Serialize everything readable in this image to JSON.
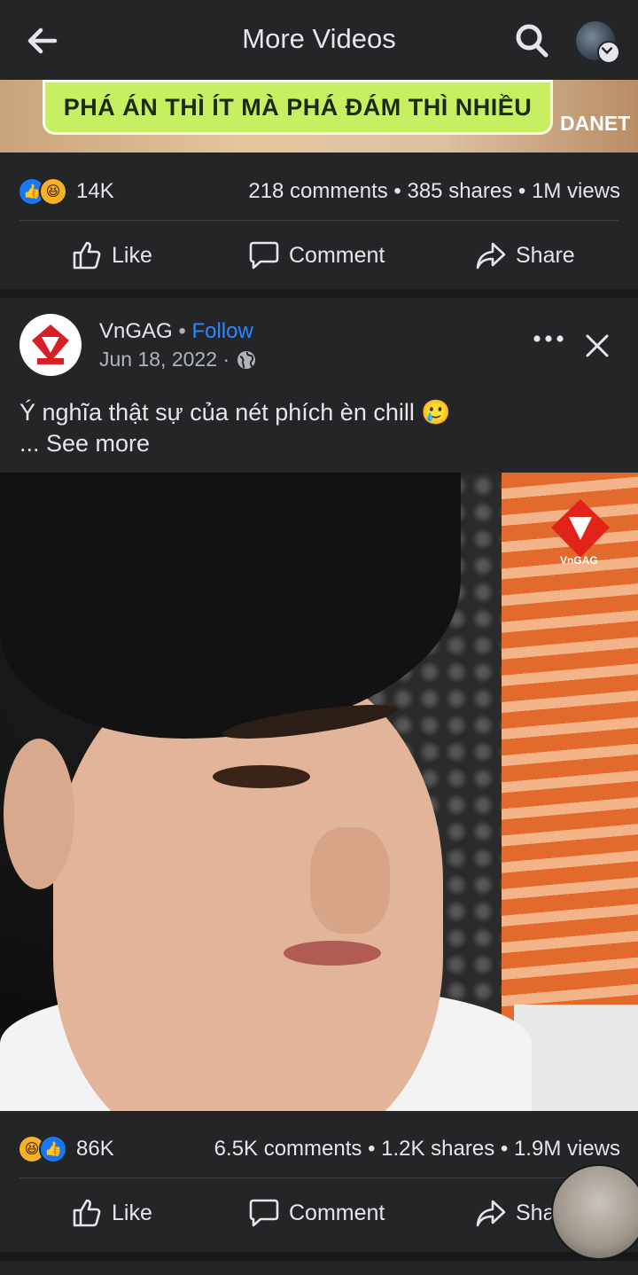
{
  "header": {
    "title": "More Videos"
  },
  "previous_post": {
    "video_caption": "PHÁ ÁN THÌ ÍT MÀ PHÁ ĐÁM THÌ NHIỀU",
    "video_watermark": "DANET",
    "reactions_count": "14K",
    "stats": "218 comments • 385 shares • 1M views",
    "actions": {
      "like": "Like",
      "comment": "Comment",
      "share": "Share"
    }
  },
  "post": {
    "page_name": "VnGAG",
    "separator": "•",
    "follow": "Follow",
    "date": "Jun 18, 2022 ·",
    "text": "Ý nghĩa thật sự của nét phích èn chill 🥲",
    "see_more": "... See more",
    "video_watermark": "VnGAG",
    "reactions_count": "86K",
    "stats": "6.5K comments • 1.2K shares • 1.9M views",
    "actions": {
      "like": "Like",
      "comment": "Comment",
      "share": "Sha"
    }
  },
  "icons": {
    "back": "arrow-left-icon",
    "search": "search-icon",
    "like": "thumbs-up-icon",
    "comment": "comment-bubble-icon",
    "share": "share-arrow-icon",
    "more": "more-horizontal-icon",
    "close": "close-icon",
    "globe": "globe-icon"
  },
  "colors": {
    "background": "#242526",
    "accent": "#2d88ff",
    "like_blue": "#1877f2",
    "haha_yellow": "#f7b125"
  }
}
